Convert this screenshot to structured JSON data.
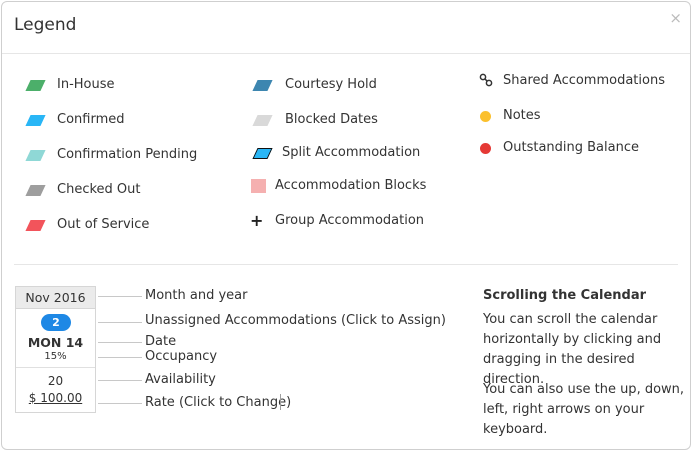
{
  "title": "Legend",
  "close_glyph": "×",
  "legend_col1": [
    {
      "label": "In-House",
      "color": "#4caf6a"
    },
    {
      "label": "Confirmed",
      "color": "#29b6f6"
    },
    {
      "label": "Confirmation Pending",
      "color": "#8fd8d6"
    },
    {
      "label": "Checked Out",
      "color": "#9e9e9e"
    },
    {
      "label": "Out of Service",
      "color": "#f2545b"
    }
  ],
  "legend_col2": [
    {
      "label": "Courtesy Hold",
      "color": "#3d86b0"
    },
    {
      "label": "Blocked Dates",
      "color": "#d9d9d9"
    },
    {
      "label": "Split Accommodation",
      "color": "#29b6f6"
    },
    {
      "label": "Accommodation Blocks",
      "color": "#f5b0b0"
    },
    {
      "label": "Group Accommodation",
      "icon": "plus-icon"
    }
  ],
  "legend_col3": [
    {
      "label": "Shared Accommodations",
      "icon": "link-icon"
    },
    {
      "label": "Notes",
      "color": "#fbc02d"
    },
    {
      "label": "Outstanding Balance",
      "color": "#e53935"
    }
  ],
  "calendar_cell": {
    "month_year": "Nov 2016",
    "unassigned_count": "2",
    "date": "MON 14",
    "occupancy": "15%",
    "availability": "20",
    "rate": "$ 100.00"
  },
  "callouts": {
    "month_year": "Month and year",
    "unassigned": "Unassigned Accommodations (Click to Assign)",
    "date": "Date",
    "occupancy": "Occupancy",
    "availability": "Availability",
    "rate": "Rate (Click to Change)"
  },
  "scrolling": {
    "heading": "Scrolling the Calendar",
    "para1": "You can scroll the calendar horizontally by clicking and dragging in the desired direction.",
    "para2": "You can also use the up, down, left, right arrows on your keyboard."
  }
}
